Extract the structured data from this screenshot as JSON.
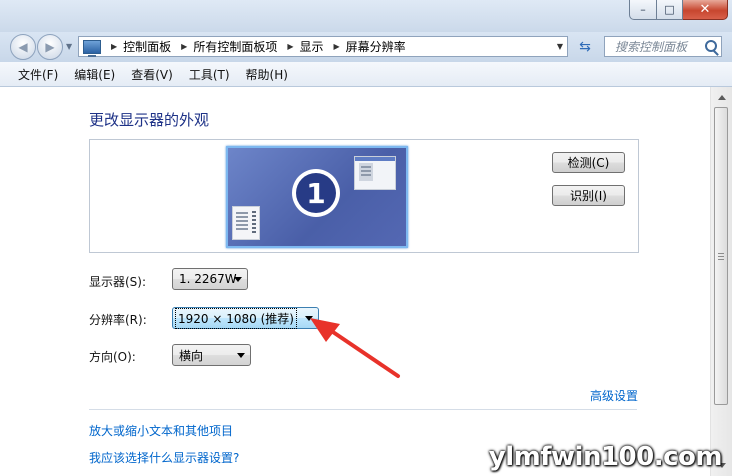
{
  "window": {
    "minimize_glyph": "–",
    "maximize_glyph": "□",
    "close_glyph": "✕"
  },
  "nav": {
    "breadcrumbs": [
      "控制面板",
      "所有控制面板项",
      "显示",
      "屏幕分辨率"
    ],
    "search_placeholder": "搜索控制面板"
  },
  "menu": {
    "items": [
      "文件(F)",
      "编辑(E)",
      "查看(V)",
      "工具(T)",
      "帮助(H)"
    ]
  },
  "main": {
    "title": "更改显示器的外观",
    "monitor_number": "1",
    "detect_button": "检测(C)",
    "identify_button": "识别(I)",
    "display_label": "显示器(S):",
    "display_value": "1. 2267W",
    "resolution_label": "分辨率(R):",
    "resolution_value": "1920 × 1080 (推荐)",
    "orientation_label": "方向(O):",
    "orientation_value": "横向",
    "advanced_link": "高级设置",
    "text_size_link": "放大或缩小文本和其他项目",
    "which_display_link": "我应该选择什么显示器设置?"
  },
  "watermark": "ylmfwin100.com",
  "colors": {
    "title_blue": "#1e3287",
    "link_blue": "#0066cc",
    "annotation_red": "#e8322a"
  }
}
